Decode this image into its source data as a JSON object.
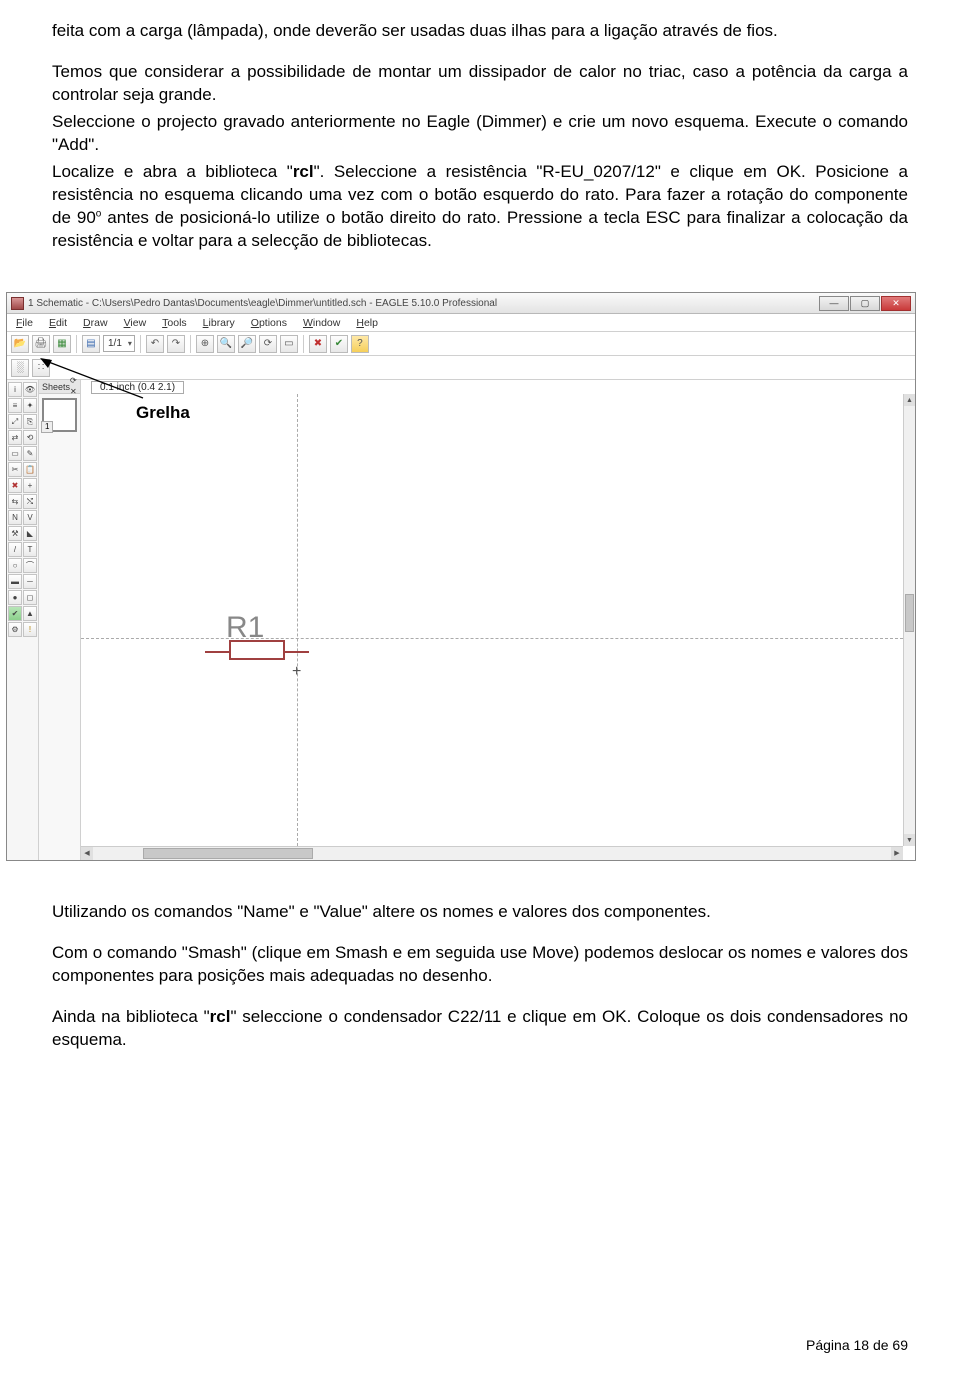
{
  "body": {
    "p1": "feita com a carga (lâmpada), onde deverão ser usadas duas ilhas para a ligação através de fios.",
    "p2a": "Temos que considerar a possibilidade de montar um dissipador de calor no triac, caso a potência da carga a controlar seja grande.",
    "p2b": "Seleccione o projecto gravado anteriormente no Eagle (Dimmer) e crie um novo esquema. Execute o comando \"Add\".",
    "p2c_1": "Localize e abra a biblioteca \"",
    "p2c_bold": "rcl",
    "p2c_2": "\". Seleccione a resistência \"R-EU_0207/12\" e clique em OK. Posicione a resistência no esquema clicando uma vez com o botão esquerdo do rato. Para fazer a rotação do componente de 90",
    "p2c_sup": "o",
    "p2c_3": " antes de posicioná-lo utilize o botão direito do rato. Pressione a tecla ESC para finalizar a colocação da resistência e voltar para a selecção de bibliotecas.",
    "p3": "Utilizando os comandos \"Name\" e \"Value\" altere os nomes e valores dos componentes.",
    "p4": "Com o comando \"Smash\" (clique em Smash e em seguida use Move) podemos deslocar os nomes e valores dos componentes para posições mais adequadas no desenho.",
    "p5_1": "Ainda na biblioteca \"",
    "p5_bold": "rcl",
    "p5_2": "\" seleccione o condensador C22/11 e clique em OK. Coloque os dois condensadores no esquema."
  },
  "annotation": {
    "label": "Grelha"
  },
  "screenshot": {
    "titlebar": "1 Schematic - C:\\Users\\Pedro Dantas\\Documents\\eagle\\Dimmer\\untitled.sch - EAGLE 5.10.0 Professional",
    "menus": {
      "file": "File",
      "edit": "Edit",
      "draw": "Draw",
      "view": "View",
      "tools": "Tools",
      "library": "Library",
      "options": "Options",
      "window": "Window",
      "help": "Help"
    },
    "toolbar": {
      "zoom_combo": "1/1",
      "coords": "0.1 inch (0.4 2.1)"
    },
    "sheets": {
      "title": "Sheets",
      "num": "1"
    },
    "canvas": {
      "res_label": "R1"
    }
  },
  "footer": {
    "page": "Página 18 de 69"
  }
}
